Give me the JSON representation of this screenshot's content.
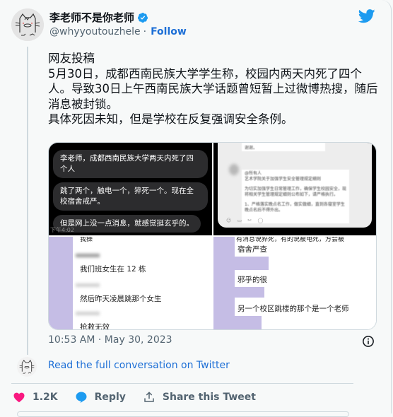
{
  "author": {
    "display_name": "李老师不是你老师",
    "handle": "@whyyoutouzhele",
    "separator": "·",
    "follow_label": "Follow",
    "verified": true
  },
  "tweet": {
    "text": "网友投稿\n5月30日，成都西南民族大学学生称，校园内两天内死了四个人。导致30日上午西南民族大学话题曾短暂上过微博热搜，随后消息被封锁。\n具体死因未知，但是学校在反复强调安全条例。",
    "timestamp": "10:53 AM · May 30, 2023"
  },
  "media": {
    "chat_dark": {
      "bubbles": [
        "李老师，成都西南民族大学两天内死了四个人",
        "跳了两个，触电一个，猝死一个。现在全校宿舍戒严。",
        "但是网上没一点消息，就感觉挺玄乎的。"
      ],
      "time": "下午4:02"
    },
    "notice": {
      "top_text": "谢谢。",
      "lines": [
        "@所有人",
        "艺术学院关于加强学生安全管理规定细则",
        "",
        "为切实加强学生日常管理工作，确保学生校园安全，现将相关学生管理规定细则公布如下，请严格执行。",
        "",
        "1、严格落实晚点名工作，做实做细，直到各寝室学生晚点名后不得外出。"
      ]
    },
    "chat_purple_left": {
      "messages": [
        "我们班女生在 12 栋",
        "然后昨天凌晨跳那个女生",
        "抢救无效"
      ],
      "top_partial": "我操"
    },
    "chat_purple_right": {
      "top_partial": "有消息说猝死，有的说被电死，方会被",
      "messages": [
        "宿舍严查",
        "邪乎的很",
        "另一个校区跳楼的那个是一个老师"
      ]
    }
  },
  "footer": {
    "read_full_label": "Read the full conversation on Twitter",
    "likes_count": "1.2K",
    "reply_label": "Reply",
    "share_label": "Share this Tweet"
  },
  "colors": {
    "like": "#f91880",
    "reply": "#1d9bf0",
    "link": "#1d6fd6",
    "twitter_blue": "#1d9bf0",
    "purple_bubble": "#c5bde5"
  }
}
